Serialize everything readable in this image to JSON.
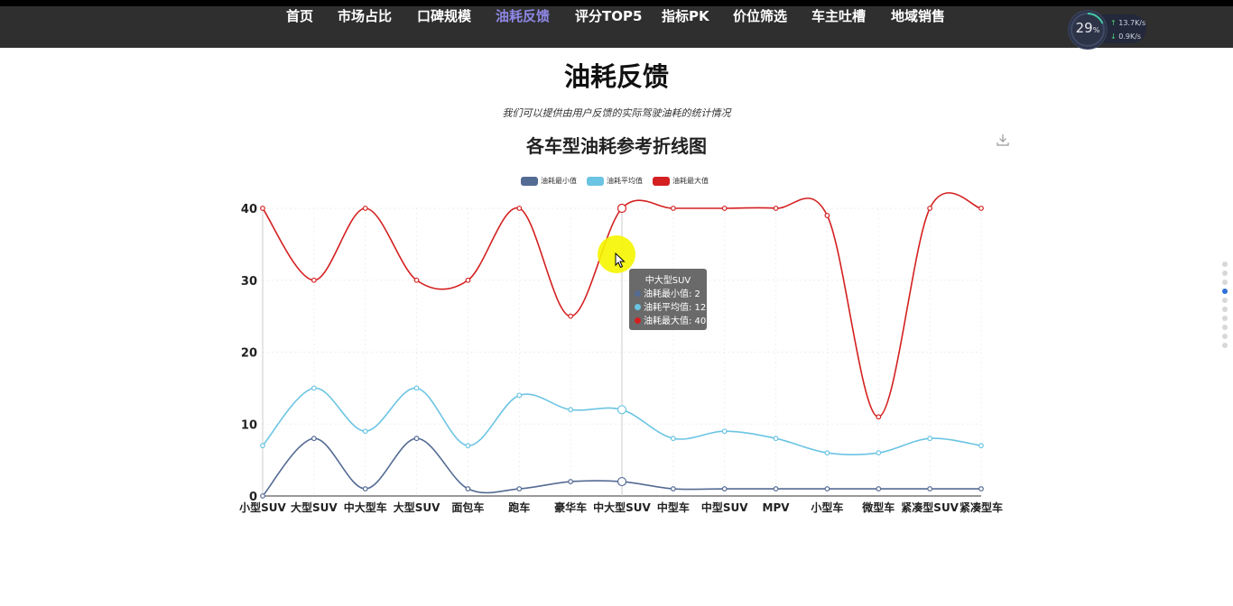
{
  "nav": {
    "items": [
      {
        "label": "首页"
      },
      {
        "label": "市场占比"
      },
      {
        "label": "口碑规模"
      },
      {
        "label": "油耗反馈"
      },
      {
        "label": "评分TOP5"
      },
      {
        "label": "指标PK"
      },
      {
        "label": "价位筛选"
      },
      {
        "label": "车主吐槽"
      },
      {
        "label": "地域销售"
      }
    ],
    "active_index": 3
  },
  "widget": {
    "percent": "29",
    "percent_unit": "%",
    "upload": "13.7K/s",
    "download": "0.9K/s"
  },
  "header": {
    "title": "油耗反馈",
    "subtitle": "我们可以提供由用户反馈的实际驾驶油耗的统计情况"
  },
  "chart_data": {
    "type": "line",
    "title": "各车型油耗参考折线图",
    "categories": [
      "小型SUV",
      "大型SUV",
      "中大型车",
      "大型SUV",
      "面包车",
      "跑车",
      "豪华车",
      "中大型SUV",
      "中型车",
      "中型SUV",
      "MPV",
      "小型车",
      "微型车",
      "紧凑型SUV",
      "紧凑型车"
    ],
    "series": [
      {
        "name": "油耗最小值",
        "color": "#546b94",
        "values": [
          0,
          8,
          1,
          8,
          1,
          1,
          2,
          2,
          1,
          1,
          1,
          1,
          1,
          1,
          1
        ]
      },
      {
        "name": "油耗平均值",
        "color": "#6bc4e3",
        "values": [
          7,
          15,
          9,
          15,
          7,
          14,
          12,
          12,
          8,
          9,
          8,
          6,
          6,
          8,
          7
        ]
      },
      {
        "name": "油耗最大值",
        "color": "#d42020",
        "values": [
          40,
          30,
          40,
          30,
          30,
          40,
          25,
          40,
          40,
          40,
          40,
          39,
          11,
          40,
          40
        ]
      }
    ],
    "ylim": [
      0,
      40
    ],
    "yticks": [
      0,
      10,
      20,
      30,
      40
    ],
    "xlabel": "",
    "ylabel": "",
    "grid": true,
    "legend_position": "top-center",
    "smooth": true
  },
  "tooltip": {
    "category": "中大型SUV",
    "rows": [
      {
        "text": "油耗最小值: 2",
        "color": "#546b94"
      },
      {
        "text": "油耗平均值: 12",
        "color": "#6bc4e3"
      },
      {
        "text": "油耗最大值: 40",
        "color": "#d42020"
      }
    ],
    "index": 7
  },
  "side_nav": {
    "count": 10,
    "active_index": 3
  },
  "icons": {
    "download": "download-icon",
    "cursor": "cursor-arrow-icon"
  }
}
